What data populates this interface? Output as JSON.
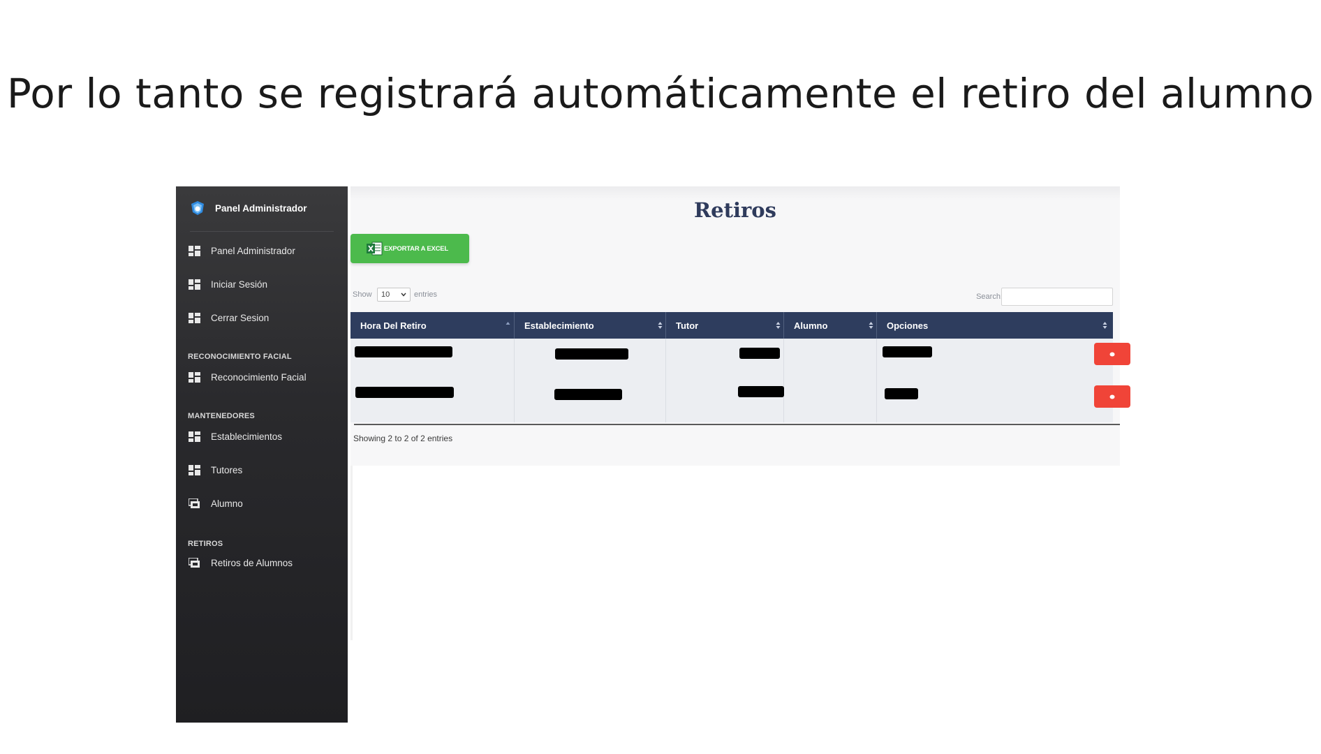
{
  "slide": {
    "title": "Por lo tanto se registrará automáticamente el retiro del alumno"
  },
  "sidebar": {
    "brand": "Panel Administrador",
    "items_top": [
      {
        "label": "Panel Administrador",
        "icon": "dashboard-icon"
      },
      {
        "label": "Iniciar Sesión",
        "icon": "dashboard-icon"
      },
      {
        "label": "Cerrar Sesion",
        "icon": "dashboard-icon"
      }
    ],
    "section_facial": "RECONOCIMIENTO FACIAL",
    "items_facial": [
      {
        "label": "Reconocimiento Facial",
        "icon": "dashboard-icon"
      }
    ],
    "section_mantenedores": "MANTENEDORES",
    "items_mantenedores": [
      {
        "label": "Establecimientos",
        "icon": "dashboard-icon"
      },
      {
        "label": "Tutores",
        "icon": "dashboard-icon"
      },
      {
        "label": "Alumno",
        "icon": "stack-icon"
      }
    ],
    "section_retiros": "RETIROS",
    "items_retiros": [
      {
        "label": "Retiros de Alumnos",
        "icon": "stack-icon"
      }
    ]
  },
  "main": {
    "page_title": "Retiros",
    "export_button": "EXPORTAR A EXCEL",
    "length": {
      "show_label": "Show",
      "value": "10",
      "entries_label": "entries"
    },
    "search_label": "Search:",
    "search_value": "",
    "table": {
      "columns": [
        "Hora Del Retiro",
        "Establecimiento",
        "Tutor",
        "Alumno",
        "Opciones"
      ],
      "rows": [
        {
          "hora": "[redacted]",
          "establecimiento": "[redacted]",
          "tutor": "[redacted]",
          "alumno": "[redacted]",
          "action": "delete"
        },
        {
          "hora": "[redacted]",
          "establecimiento": "[redacted]",
          "tutor": "[redacted]",
          "alumno": "[redacted]",
          "action": "delete"
        }
      ]
    },
    "info_text": "Showing 2 to 2 of 2 entries"
  },
  "colors": {
    "sidebar_bg": "#2a2a2d",
    "table_header_bg": "#2e3d5e",
    "title_color": "#2f3b5c",
    "export_green": "#4cba4c",
    "delete_red": "#f04438"
  }
}
